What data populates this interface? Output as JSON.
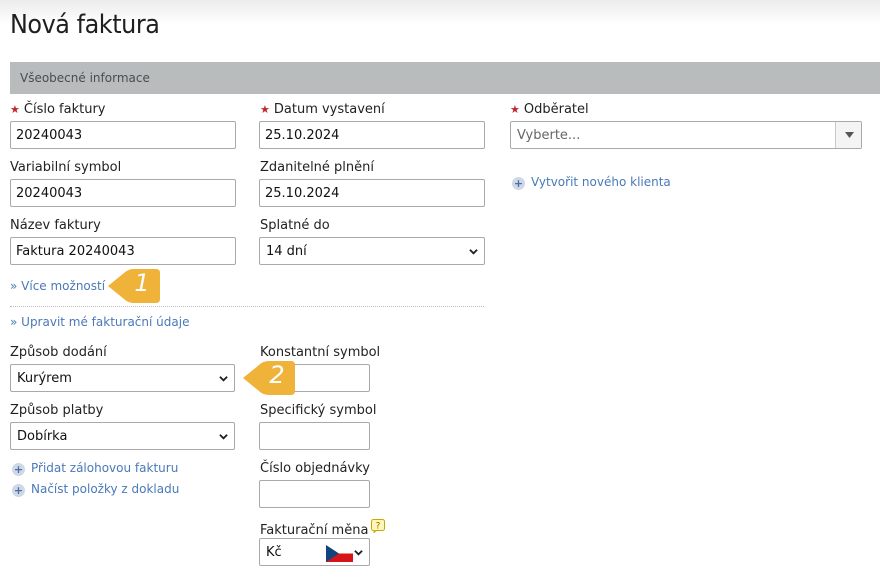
{
  "page": {
    "title": "Nová faktura"
  },
  "section": {
    "title": "Všeobecné informace"
  },
  "fields": {
    "invoice_number": {
      "label": "Číslo faktury",
      "value": "20240043",
      "required": true
    },
    "issue_date": {
      "label": "Datum vystavení",
      "value": "25.10.2024",
      "required": true
    },
    "client": {
      "label": "Odběratel",
      "placeholder": "Vyberte...",
      "required": true
    },
    "variable_symbol": {
      "label": "Variabilní symbol",
      "value": "20240043"
    },
    "taxable_date": {
      "label": "Zdanitelné plnění",
      "value": "25.10.2024"
    },
    "invoice_name": {
      "label": "Název faktury",
      "value": "Faktura 20240043"
    },
    "due": {
      "label": "Splatné do",
      "value": "14 dní"
    },
    "delivery_method": {
      "label": "Způsob dodání",
      "value": "Kurýrem"
    },
    "payment_method": {
      "label": "Způsob platby",
      "value": "Dobírka"
    },
    "constant_symbol": {
      "label": "Konstantní symbol",
      "value": ""
    },
    "specific_symbol": {
      "label": "Specifický symbol",
      "value": ""
    },
    "order_number": {
      "label": "Číslo objednávky",
      "value": ""
    },
    "currency": {
      "label": "Fakturační měna",
      "value": "Kč"
    }
  },
  "links": {
    "create_client": "Vytvořit nového klienta",
    "more_options": "» Více možností",
    "edit_billing": "» Upravit mé fakturační údaje",
    "add_advance": "Přidat zálohovou fakturu",
    "load_items": "Načíst položky z dokladu"
  },
  "badges": {
    "one": "1",
    "two": "2"
  },
  "icons": {
    "required": "asterisk-icon",
    "add": "plus-circle-icon",
    "dropdown": "chevron-down-icon",
    "help": "question-icon",
    "flag": "czech-flag-icon"
  },
  "colors": {
    "accent_link": "#4a79b8",
    "section_bg": "#b8bcbd",
    "required": "#c0272d",
    "badge": "#f0b33a"
  }
}
